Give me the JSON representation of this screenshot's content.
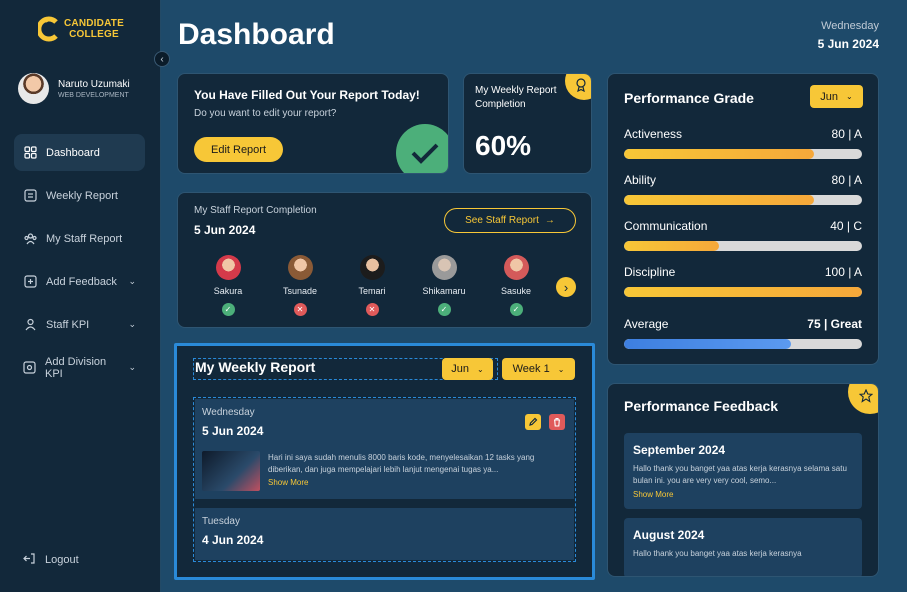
{
  "brand": {
    "line1": "CANDIDATE",
    "line2": "COLLEGE",
    "color": "#f7c737"
  },
  "user": {
    "name": "Naruto Uzumaki",
    "role": "WEB DEVELOPMENT"
  },
  "sidebar": {
    "items": [
      {
        "label": "Dashboard",
        "icon": "grid-icon"
      },
      {
        "label": "Weekly Report",
        "icon": "report-icon"
      },
      {
        "label": "My Staff Report",
        "icon": "staff-icon"
      },
      {
        "label": "Add Feedback",
        "icon": "plus-square-icon"
      },
      {
        "label": "Staff KPI",
        "icon": "person-icon"
      },
      {
        "label": "Add Division KPI",
        "icon": "division-icon"
      }
    ],
    "logout": "Logout"
  },
  "header": {
    "title": "Dashboard",
    "day": "Wednesday",
    "date": "5 Jun 2024"
  },
  "report_filled": {
    "title": "You Have Filled Out Your Report Today!",
    "question": "Do you want to edit your report?",
    "button": "Edit Report"
  },
  "weekly_completion": {
    "label": "My Weekly Report Completion",
    "value": "60%"
  },
  "staff_completion": {
    "title": "My Staff Report Completion",
    "date": "5 Jun 2024",
    "button": "See Staff Report",
    "staff": [
      {
        "name": "Sakura",
        "status": "done"
      },
      {
        "name": "Tsunade",
        "status": "missing"
      },
      {
        "name": "Temari",
        "status": "missing"
      },
      {
        "name": "Shikamaru",
        "status": "done"
      },
      {
        "name": "Sasuke",
        "status": "done"
      }
    ]
  },
  "weekly_report": {
    "title": "My Weekly Report",
    "month": "Jun",
    "week": "Week 1",
    "entries": [
      {
        "day": "Wednesday",
        "date": "5 Jun 2024",
        "text": "Hari ini saya sudah menulis 8000 baris kode, menyelesaikan 12 tasks yang diberikan, dan juga mempelajari lebih lanjut mengenai tugas ya...",
        "more": "Show More"
      },
      {
        "day": "Tuesday",
        "date": "4 Jun 2024"
      }
    ]
  },
  "performance": {
    "title": "Performance Grade",
    "month": "Jun",
    "grades": [
      {
        "label": "Activeness",
        "score": "80 | A",
        "pct": 0.8
      },
      {
        "label": "Ability",
        "score": "80 | A",
        "pct": 0.8
      },
      {
        "label": "Communication",
        "score": "40 | C",
        "pct": 0.4
      },
      {
        "label": "Discipline",
        "score": "100 | A",
        "pct": 1.0
      },
      {
        "label": "Average",
        "score": "75 | Great",
        "pct": 0.7
      }
    ]
  },
  "feedback": {
    "title": "Performance Feedback",
    "items": [
      {
        "month": "September  2024",
        "text": "Hallo thank you banget yaa atas kerja kerasnya selama satu bulan ini. you are very very cool, semo...",
        "more": "Show More"
      },
      {
        "month": "August 2024",
        "text": "Hallo thank you banget yaa atas kerja kerasnya"
      }
    ]
  },
  "colors": {
    "accent": "#f7c737",
    "done": "#4caf7a",
    "missing": "#e05a5a",
    "average_bar": "#3d7fe0"
  }
}
